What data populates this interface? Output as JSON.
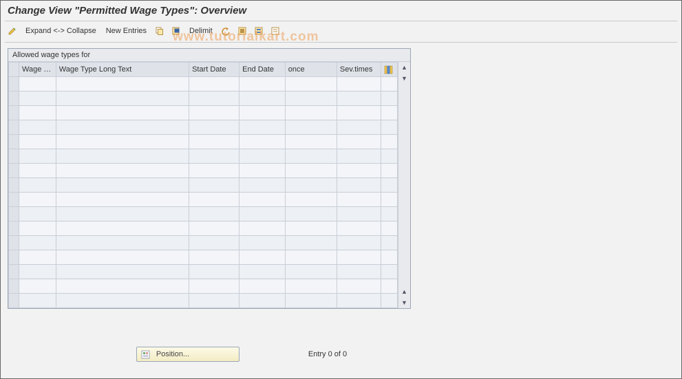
{
  "header": {
    "title": "Change View \"Permitted Wage Types\": Overview"
  },
  "toolbar": {
    "expand_collapse_label": "Expand <-> Collapse",
    "new_entries_label": "New Entries",
    "delimit_label": "Delimit",
    "icons": {
      "edit": "edit-icon",
      "copy": "copy-icon",
      "delete": "delete-icon",
      "undo": "undo-icon",
      "select_all": "select-all-icon",
      "select_block": "select-block-icon",
      "deselect": "deselect-icon"
    }
  },
  "panel": {
    "title": "Allowed wage types for",
    "columns": {
      "wage_type": "Wage T...",
      "long_text": "Wage Type Long Text",
      "start_date": "Start Date",
      "end_date": "End Date",
      "once": "once",
      "sev_times": "Sev.times"
    },
    "rows": [
      {
        "wage_type": "",
        "long_text": "",
        "start_date": "",
        "end_date": "",
        "once": "",
        "sev_times": ""
      },
      {
        "wage_type": "",
        "long_text": "",
        "start_date": "",
        "end_date": "",
        "once": "",
        "sev_times": ""
      },
      {
        "wage_type": "",
        "long_text": "",
        "start_date": "",
        "end_date": "",
        "once": "",
        "sev_times": ""
      },
      {
        "wage_type": "",
        "long_text": "",
        "start_date": "",
        "end_date": "",
        "once": "",
        "sev_times": ""
      },
      {
        "wage_type": "",
        "long_text": "",
        "start_date": "",
        "end_date": "",
        "once": "",
        "sev_times": ""
      },
      {
        "wage_type": "",
        "long_text": "",
        "start_date": "",
        "end_date": "",
        "once": "",
        "sev_times": ""
      },
      {
        "wage_type": "",
        "long_text": "",
        "start_date": "",
        "end_date": "",
        "once": "",
        "sev_times": ""
      },
      {
        "wage_type": "",
        "long_text": "",
        "start_date": "",
        "end_date": "",
        "once": "",
        "sev_times": ""
      },
      {
        "wage_type": "",
        "long_text": "",
        "start_date": "",
        "end_date": "",
        "once": "",
        "sev_times": ""
      },
      {
        "wage_type": "",
        "long_text": "",
        "start_date": "",
        "end_date": "",
        "once": "",
        "sev_times": ""
      },
      {
        "wage_type": "",
        "long_text": "",
        "start_date": "",
        "end_date": "",
        "once": "",
        "sev_times": ""
      },
      {
        "wage_type": "",
        "long_text": "",
        "start_date": "",
        "end_date": "",
        "once": "",
        "sev_times": ""
      },
      {
        "wage_type": "",
        "long_text": "",
        "start_date": "",
        "end_date": "",
        "once": "",
        "sev_times": ""
      },
      {
        "wage_type": "",
        "long_text": "",
        "start_date": "",
        "end_date": "",
        "once": "",
        "sev_times": ""
      },
      {
        "wage_type": "",
        "long_text": "",
        "start_date": "",
        "end_date": "",
        "once": "",
        "sev_times": ""
      },
      {
        "wage_type": "",
        "long_text": "",
        "start_date": "",
        "end_date": "",
        "once": "",
        "sev_times": ""
      }
    ]
  },
  "footer": {
    "position_label": "Position...",
    "entry_text": "Entry 0 of 0"
  },
  "watermark": "www.tutorialkart.com"
}
